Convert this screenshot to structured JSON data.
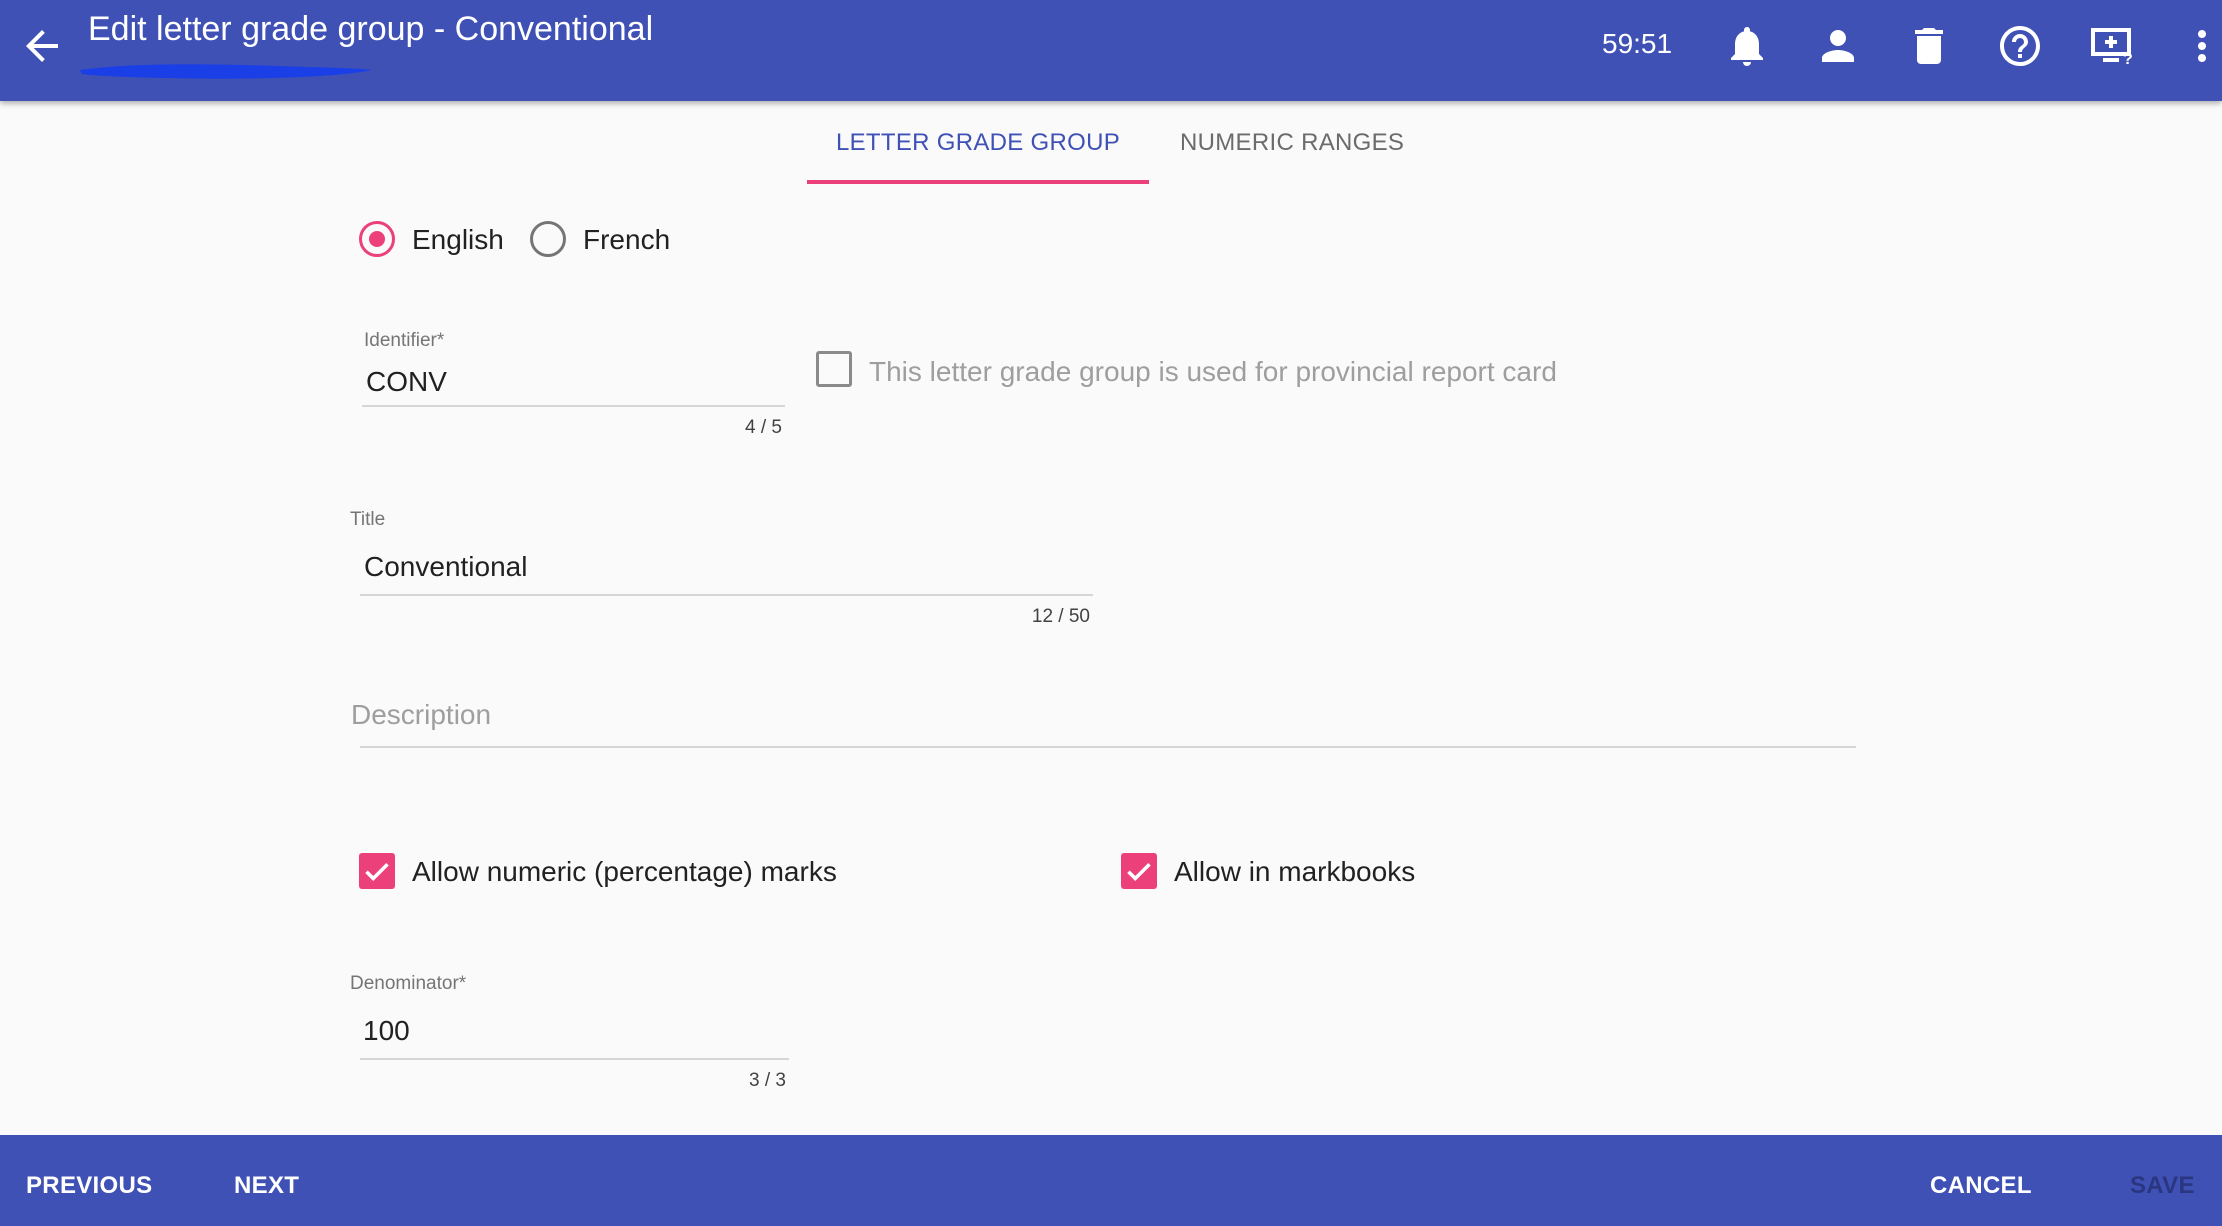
{
  "header": {
    "title": "Edit letter grade group - Conventional",
    "timer": "59:51",
    "icons": [
      "back-arrow-icon",
      "bell-icon",
      "user-icon",
      "trash-icon",
      "help-icon",
      "screen-help-icon",
      "more-vert-icon"
    ]
  },
  "tabs": [
    {
      "label": "LETTER GRADE GROUP",
      "active": true
    },
    {
      "label": "NUMERIC RANGES",
      "active": false
    }
  ],
  "language": {
    "options": [
      {
        "label": "English",
        "selected": true
      },
      {
        "label": "French",
        "selected": false
      }
    ]
  },
  "identifier": {
    "label": "Identifier",
    "required_mark": "*",
    "value": "CONV",
    "counter": "4 / 5"
  },
  "provincial": {
    "label": "This letter grade group is used for provincial report card",
    "checked": false
  },
  "title_field": {
    "label": "Title",
    "value": "Conventional",
    "counter": "12 / 50"
  },
  "description": {
    "placeholder": "Description",
    "value": ""
  },
  "allow_numeric": {
    "label": "Allow numeric (percentage) marks",
    "checked": true
  },
  "allow_markbooks": {
    "label": "Allow in markbooks",
    "checked": true
  },
  "denominator": {
    "label": "Denominator",
    "required_mark": "*",
    "value": "100",
    "counter": "3 / 3"
  },
  "footer": {
    "previous": "PREVIOUS",
    "next": "NEXT",
    "cancel": "CANCEL",
    "save": "SAVE"
  },
  "colors": {
    "primary": "#3f51b5",
    "accent": "#ec407a",
    "scribble": "#1a3fe6"
  }
}
